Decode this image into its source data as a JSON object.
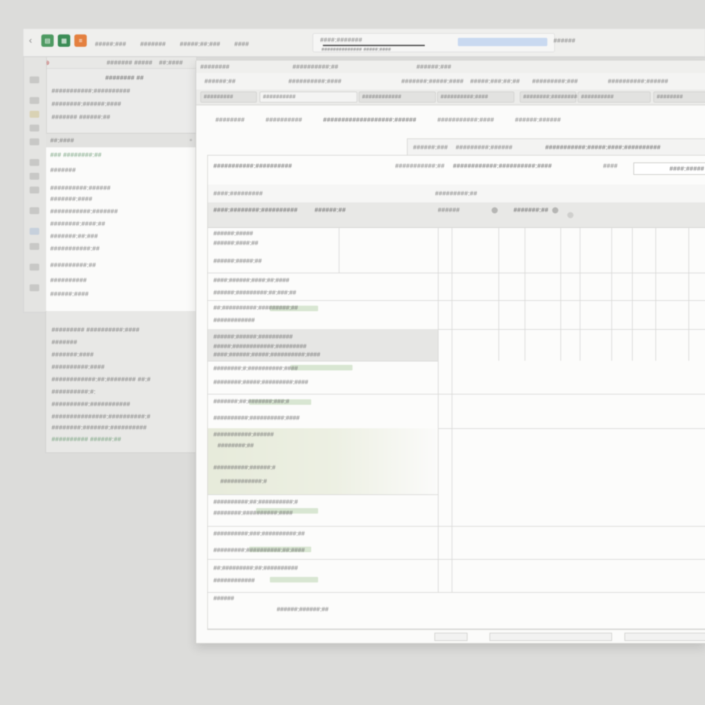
{
  "app_bar": {
    "back_icon": "chevron-left-icon",
    "app_icons": [
      {
        "name": "sheets-icon",
        "color": "#4e9a62",
        "glyph": "▤"
      },
      {
        "name": "spreadsheet-icon",
        "color": "#3b8c55",
        "glyph": "▦"
      },
      {
        "name": "orange-app-icon",
        "color": "#e4803f",
        "glyph": "≡"
      }
    ],
    "menu": [
      "#####:###",
      "#######",
      "#####:##:###",
      "####"
    ],
    "address_text": "####:#######",
    "address_sub": "##############  #####:####",
    "right_text": "######"
  },
  "left_panel": {
    "toolbar": [
      "∎ ⊘ ⊛",
      "#######  #####",
      "##:####"
    ],
    "header_list": [
      "########  ##",
      "###########:##########",
      "########:######:####",
      "#######  ######:##"
    ],
    "section_title": "##:####",
    "list": [
      "### ########:##",
      "#######",
      "##########:######",
      "#######:####",
      "###########:#######",
      "########:####:##",
      "#######:##:###",
      "###########:##",
      "##########:##",
      "##########",
      "######:####"
    ],
    "lower": [
      "#########  ##########:####",
      "#######",
      "#######:####",
      "##########:####",
      "############:##:######## ##:#",
      "##########:#:",
      "##########:###########",
      "###############:##########:#",
      "########:#######:##########",
      "##########  ######:##"
    ]
  },
  "doc": {
    "tabbar": [
      "########",
      "##########:##",
      "######:###"
    ],
    "toolbar": [
      "######:##",
      "##########:####",
      "#######:#####:####",
      "#####:###:##:##",
      "#########:###",
      "##########:######"
    ],
    "filters": [
      "#########",
      "##########",
      "############",
      "##########:####",
      "########:##########",
      "##########",
      "########"
    ],
    "heading": [
      "########",
      "##########",
      "###################:######",
      "###########:####",
      "######:######"
    ],
    "col_header_top": [
      "######:###",
      "#########:######",
      "###########:#####:####:##########"
    ],
    "title_row": {
      "left": "###########:##########",
      "mid": "###########:##",
      "mid2": "############:##########:####",
      "right": "####",
      "date": "####:#####"
    },
    "sub_row": [
      "####:#########",
      "#########:##"
    ],
    "table_header": [
      "####:########:##########",
      "######:##",
      "######",
      "#######:##"
    ],
    "rows": [
      {
        "lines": [
          "######:#####",
          "######:####:##",
          "######:#####:##"
        ]
      },
      {
        "lines": [
          "####:######:####:##:####",
          "######:#########:##:###:##"
        ]
      },
      {
        "lines": [
          "##:##########:#########:##",
          "############"
        ]
      },
      {
        "lines": [
          "######:######:##########",
          "#####:############:#########",
          "####:######:#####:##########:####"
        ]
      },
      {
        "lines": [
          "########:#:##########:####",
          "########:#####:#########:####"
        ]
      },
      {
        "lines": [
          "#######:##:#######:###:#",
          "##########:##########:####"
        ]
      },
      {
        "lines": [
          "###########:######",
          "########:##",
          "##########:######:#",
          "############:#"
        ]
      },
      {
        "lines": [
          "##########:##:##########:#",
          "########:##########:####"
        ]
      },
      {
        "lines": [
          "##########:###:##########:##",
          "#########:##########:##:####"
        ]
      },
      {
        "lines": [
          "##:#########:##:##########",
          "############"
        ]
      }
    ],
    "footer": [
      "######",
      "######:######:##"
    ]
  },
  "colors": {
    "accent_green": "#4e9a62",
    "accent_orange": "#e4803f",
    "highlight_green": "#e7ebdb",
    "highlight_gray": "#e6e6e4"
  }
}
